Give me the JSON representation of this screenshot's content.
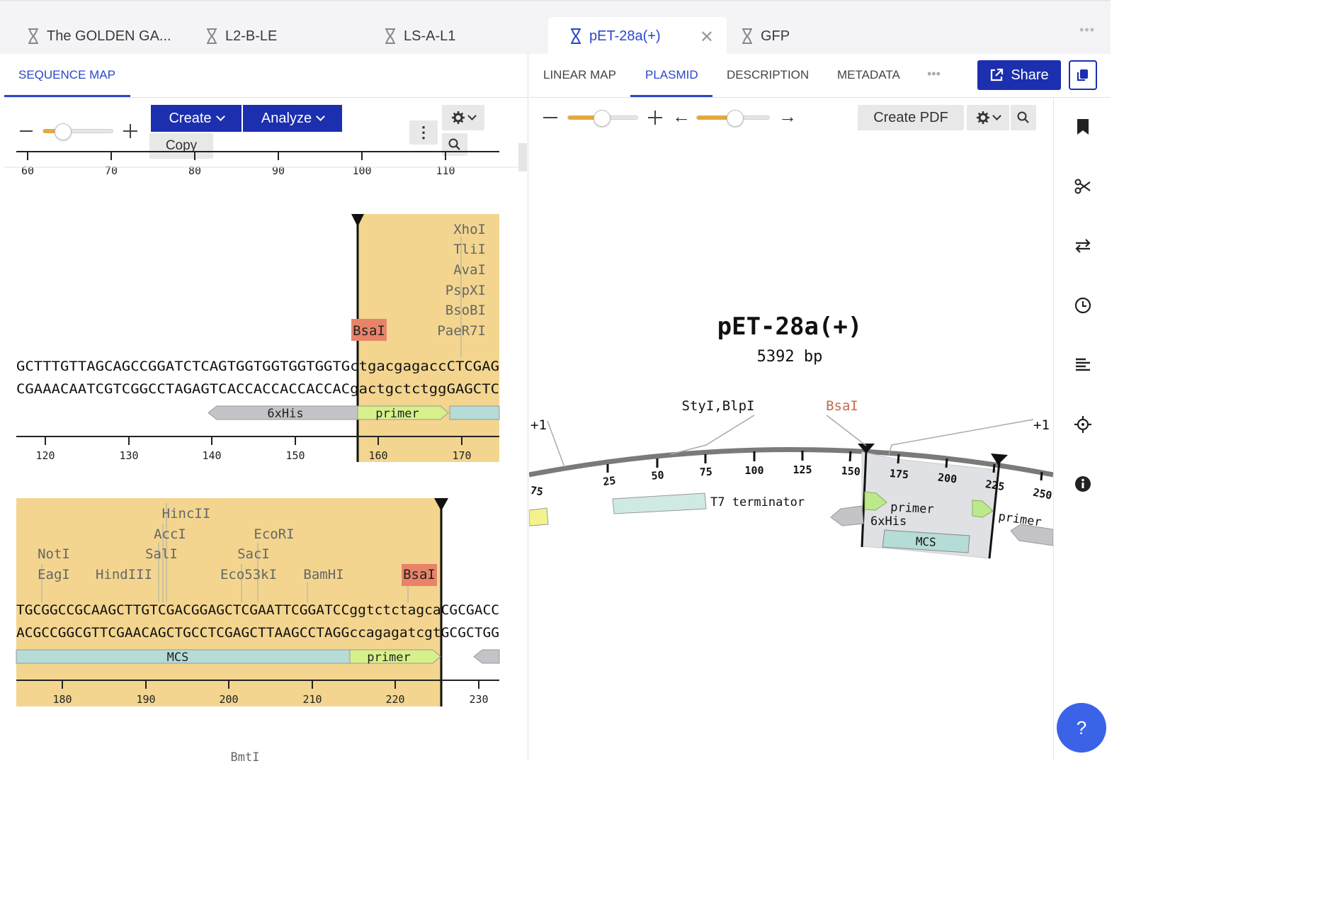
{
  "tabs": [
    {
      "label": "The GOLDEN GA..."
    },
    {
      "label": "L2-B-LE"
    },
    {
      "label": "LS-A-L1"
    },
    {
      "label": "pET-28a(+)"
    },
    {
      "label": "GFP"
    }
  ],
  "left": {
    "tab": "SEQUENCE MAP",
    "create_label": "Create",
    "analyze_label": "Analyze",
    "copy_label": "Copy",
    "top_ruler": [
      "60",
      "70",
      "80",
      "90",
      "100",
      "110"
    ],
    "block1": {
      "enzymes": [
        "XhoI",
        "TliI",
        "AvaI",
        "PspXI",
        "BsoBI",
        "PaeR7I"
      ],
      "bsai": "BsaI",
      "top_seq_upper": "GCTTTGTTAGCAGCCGGATCTCAGTGGTGGTGGTGGTG",
      "top_seq_lower": "ctgacgagacc",
      "top_seq_end": "CTCGAG",
      "bottom_seq_upper": "CGAAACAATCGTCGGCCTAGAGTCACCACCACCACCAC",
      "bottom_seq_lower": "gactgctctgg",
      "bottom_seq_end": "GAGCTC",
      "features": [
        "6xHis",
        "primer"
      ],
      "ruler": [
        "120",
        "130",
        "140",
        "150",
        "160",
        "170"
      ]
    },
    "block2": {
      "enzymes": [
        "HincII",
        "AccI",
        "SalI",
        "NotI",
        "EagI",
        "HindIII",
        "EcoRI",
        "SacI",
        "Eco53kI",
        "BamHI"
      ],
      "bsai": "BsaI",
      "top_seq_a": "TGCGGCCGCAAGCTTGTCGACGGAGCTCGAATTCGGATCC",
      "top_seq_b": "ggtctctagca",
      "top_seq_c": "CGCGACC",
      "bottom_seq_a": "ACGCCGGCGTTCGAACAGCTGCCTCGAGCTTAAGCCTAGG",
      "bottom_seq_b": "ccagagatcgt",
      "bottom_seq_c": "GCGCTGG",
      "features": [
        "MCS",
        "primer"
      ],
      "ruler": [
        "180",
        "190",
        "200",
        "210",
        "220",
        "230"
      ],
      "cut_enzyme": "BmtI"
    }
  },
  "right": {
    "view_tabs": [
      "LINEAR MAP",
      "PLASMID",
      "DESCRIPTION",
      "METADATA"
    ],
    "share_label": "Share",
    "create_pdf_label": "Create PDF",
    "plasmid": {
      "name": "pET-28a(+)",
      "length": "5392 bp",
      "labels": {
        "styi_blpi": "StyI,BlpI",
        "bsai": "BsaI",
        "plus1_left": "+1",
        "plus1_right": "+1"
      },
      "ticks": [
        "75",
        "25",
        "50",
        "75",
        "100",
        "125",
        "150",
        "175",
        "200",
        "225",
        "250"
      ],
      "features": [
        "T7 terminator",
        "primer",
        "6xHis",
        "MCS",
        "primer"
      ]
    }
  },
  "help_label": "?",
  "colors": {
    "accent": "#1c2fae",
    "selection": "#f3d58f",
    "bsai_box": "#e8836a",
    "primer": "#d7f08a",
    "his": "#c4c4c8",
    "mcs": "#b5dcd6"
  }
}
